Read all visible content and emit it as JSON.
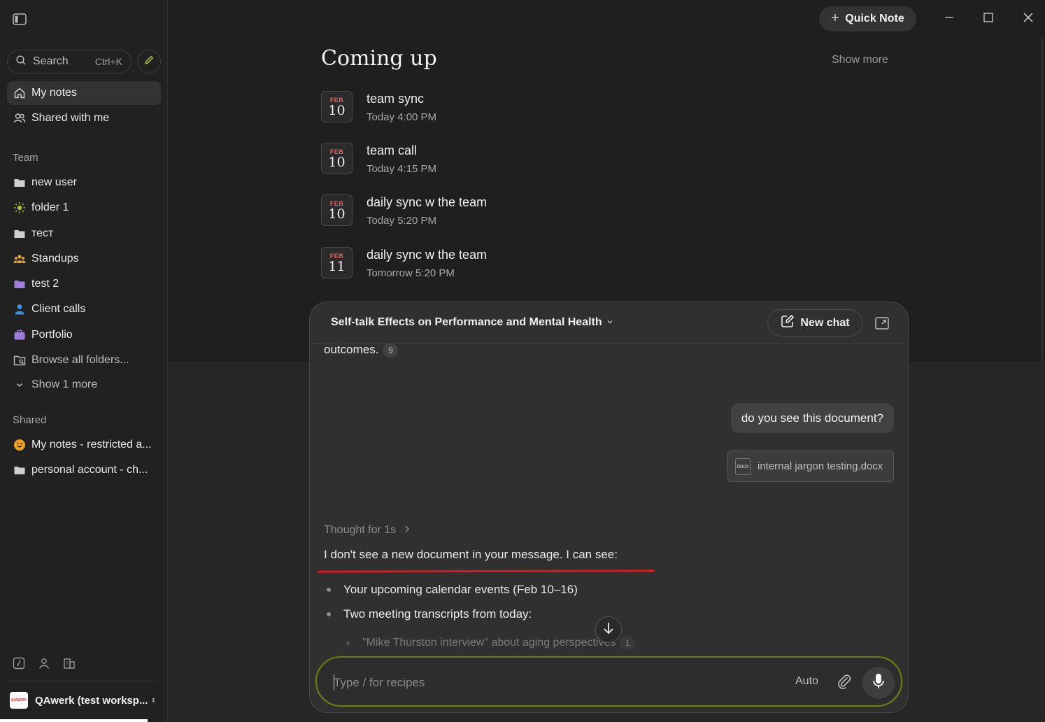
{
  "sidebar": {
    "search": {
      "label": "Search",
      "shortcut": "Ctrl+K"
    },
    "nav": [
      {
        "label": "My notes",
        "icon": "home-icon",
        "active": true
      },
      {
        "label": "Shared with me",
        "icon": "people-icon",
        "active": false
      }
    ],
    "team": {
      "heading": "Team",
      "items": [
        {
          "label": "new user",
          "icon": "folder-icon"
        },
        {
          "label": "folder 1",
          "icon": "sun-icon"
        },
        {
          "label": "тест",
          "icon": "folder-icon"
        },
        {
          "label": "Standups",
          "icon": "people-icon"
        },
        {
          "label": "test 2",
          "icon": "folder-icon"
        },
        {
          "label": "Client calls",
          "icon": "person-icon"
        },
        {
          "label": "Portfolio",
          "icon": "briefcase-icon"
        },
        {
          "label": "Browse all folders...",
          "icon": "folder-search-icon"
        },
        {
          "label": "Show 1 more",
          "icon": "chevron-down-icon"
        }
      ]
    },
    "shared": {
      "heading": "Shared",
      "items": [
        {
          "label": "My notes - restricted a...",
          "icon": "smiley-icon"
        },
        {
          "label": "personal account - ch...",
          "icon": "folder-icon"
        }
      ]
    },
    "workspace": {
      "name": "QAwerk (test worksp...",
      "logo_text": "QAWERK"
    }
  },
  "topbar": {
    "quick_note": "Quick Note"
  },
  "coming_up": {
    "title": "Coming up",
    "show_more": "Show more",
    "events": [
      {
        "month": "FEB",
        "day": "10",
        "title": "team sync",
        "time": "Today 4:00 PM"
      },
      {
        "month": "FEB",
        "day": "10",
        "title": "team call",
        "time": "Today 4:15 PM"
      },
      {
        "month": "FEB",
        "day": "10",
        "title": "daily sync w the team",
        "time": "Today 5:20 PM"
      },
      {
        "month": "FEB",
        "day": "11",
        "title": "daily sync w the team",
        "time": "Tomorrow 5:20 PM"
      }
    ]
  },
  "chat": {
    "title": "Self-talk Effects on Performance and Mental Health",
    "new_chat": "New chat",
    "prev_text": "outcomes.",
    "prev_cite": "9",
    "user_message": "do you see this document?",
    "attachment": {
      "type": "docx",
      "name": "internal jargon testing.docx"
    },
    "thought": "Thought for 1s",
    "answer": "I don't see a new document in your message. I can see:",
    "bullets": [
      "Your upcoming calendar events (Feb 10–16)",
      "Two meeting transcripts from today:"
    ],
    "sub_bullet": "\"Mike Thurston interview\" about aging perspectives",
    "sub_cite": "1",
    "input_placeholder": "Type / for recipes",
    "mode": "Auto"
  },
  "colors": {
    "accent": "#6b7a1e",
    "annotation": "#e3161c",
    "date_month": "#e0605a"
  }
}
